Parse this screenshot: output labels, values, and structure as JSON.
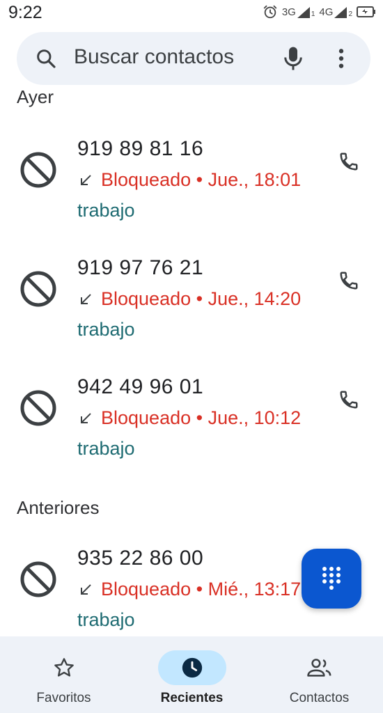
{
  "status": {
    "time": "9:22",
    "network1": "3G",
    "sim1": "1",
    "network2": "4G",
    "sim2": "2"
  },
  "search": {
    "placeholder": "Buscar contactos"
  },
  "sections": [
    {
      "header": "Ayer",
      "entries": [
        {
          "number": "919 89 81 16",
          "status": "Bloqueado",
          "time": "Jue., 18:01",
          "label": "trabajo"
        },
        {
          "number": "919 97 76 21",
          "status": "Bloqueado",
          "time": "Jue., 14:20",
          "label": "trabajo"
        },
        {
          "number": "942 49 96 01",
          "status": "Bloqueado",
          "time": "Jue., 10:12",
          "label": "trabajo"
        }
      ]
    },
    {
      "header": "Anteriores",
      "entries": [
        {
          "number": "935 22 86 00",
          "status": "Bloqueado",
          "time": "Mié., 13:17",
          "label": "trabajo"
        }
      ]
    }
  ],
  "detail_separator": " • ",
  "nav": {
    "items": [
      {
        "label": "Favoritos",
        "icon": "star-icon"
      },
      {
        "label": "Recientes",
        "icon": "clock-icon"
      },
      {
        "label": "Contactos",
        "icon": "people-icon"
      }
    ]
  },
  "colors": {
    "blocked": "#d93025",
    "label": "#1e6b72",
    "fab": "#0b57d0",
    "nav_active": "#c2e7ff"
  }
}
